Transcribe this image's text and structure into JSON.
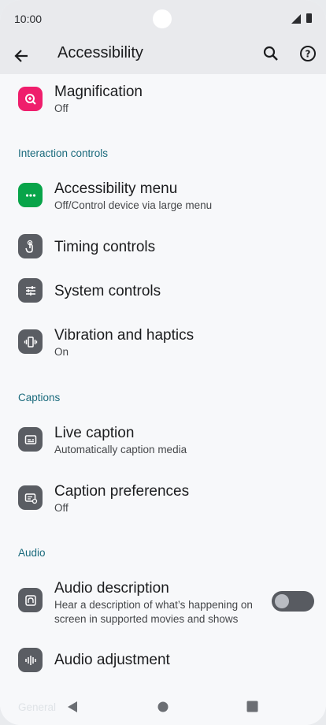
{
  "status_bar": {
    "time": "10:00"
  },
  "app_bar": {
    "title": "Accessibility"
  },
  "items": [
    {
      "id": "magnification",
      "title": "Magnification",
      "subtitle": "Off",
      "icon": "zoom-in-icon",
      "color": "#ef1e6c"
    },
    {
      "id": "accessibility-menu",
      "title": "Accessibility menu",
      "subtitle": "Off/Control device via large menu",
      "icon": "more-horizontal-icon",
      "color": "#08a449"
    },
    {
      "id": "timing-controls",
      "title": "Timing controls",
      "subtitle": "",
      "icon": "touch-timer-icon",
      "color": "#5a5d63"
    },
    {
      "id": "system-controls",
      "title": "System controls",
      "subtitle": "",
      "icon": "tune-sliders-icon",
      "color": "#5a5d63"
    },
    {
      "id": "vibration-haptics",
      "title": "Vibration and haptics",
      "subtitle": "On",
      "icon": "vibration-icon",
      "color": "#5a5d63"
    },
    {
      "id": "live-caption",
      "title": "Live caption",
      "subtitle": "Automatically caption media",
      "icon": "caption-icon",
      "color": "#5a5d63"
    },
    {
      "id": "caption-preferences",
      "title": "Caption preferences",
      "subtitle": "Off",
      "icon": "caption-settings-icon",
      "color": "#5a5d63"
    },
    {
      "id": "audio-description",
      "title": "Audio description",
      "subtitle": "Hear a description of what’s happening on screen in supported movies and shows",
      "icon": "audio-description-icon",
      "color": "#5a5d63",
      "toggle_on": false
    },
    {
      "id": "audio-adjustment",
      "title": "Audio adjustment",
      "subtitle": "",
      "icon": "waveform-icon",
      "color": "#5a5d63"
    }
  ],
  "sections": {
    "interaction": "Interaction controls",
    "captions": "Captions",
    "audio": "Audio",
    "general": "General"
  },
  "colors": {
    "accent": "#1a6a7c",
    "app_bar_bg": "#e9eaed",
    "page_bg": "#f7f8fa"
  }
}
